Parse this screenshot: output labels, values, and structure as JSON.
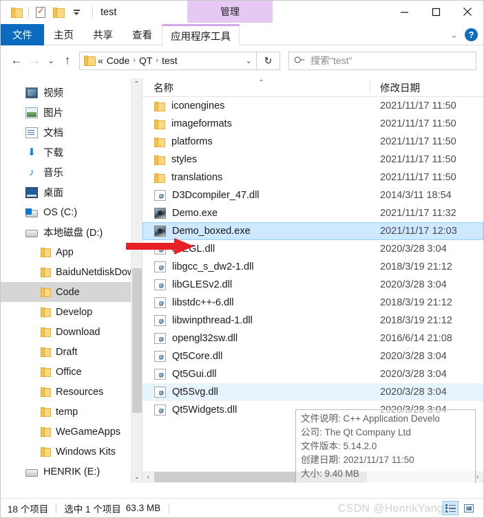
{
  "window": {
    "title": "test",
    "quick_access": [
      {
        "name": "folder-icon",
        "label": ""
      },
      {
        "name": "properties-icon",
        "label": ""
      },
      {
        "name": "new-folder-icon",
        "label": ""
      },
      {
        "name": "customize-qat-caret",
        "label": ""
      }
    ],
    "context_tab": "管理",
    "controls": {
      "minimize": "—",
      "maximize": "☐",
      "close": "✕"
    }
  },
  "ribbon": {
    "tabs": [
      {
        "label": "文件",
        "state": "file-menu"
      },
      {
        "label": "主页",
        "state": "normal"
      },
      {
        "label": "共享",
        "state": "normal"
      },
      {
        "label": "查看",
        "state": "normal"
      },
      {
        "label": "应用程序工具",
        "state": "contextual-active"
      }
    ],
    "collapse_chevron": "⌄",
    "help_label": "?"
  },
  "address_bar": {
    "back": "←",
    "forward": "→",
    "recent_caret": "⌄",
    "up": "↑",
    "breadcrumb_prefix": "«",
    "breadcrumb": [
      "Code",
      "QT",
      "test"
    ],
    "breadcrumb_separator": "›",
    "breadcrumb_caret": "⌄",
    "refresh": "↻",
    "search_placeholder": "搜索\"test\"",
    "search_value": ""
  },
  "sidebar": {
    "items": [
      {
        "label": "视频",
        "icon": "video-icon",
        "type": "library",
        "selected": false
      },
      {
        "label": "图片",
        "icon": "pictures-icon",
        "type": "library",
        "selected": false
      },
      {
        "label": "文档",
        "icon": "documents-icon",
        "type": "library",
        "selected": false
      },
      {
        "label": "下载",
        "icon": "downloads-icon",
        "type": "library",
        "selected": false
      },
      {
        "label": "音乐",
        "icon": "music-icon",
        "type": "library",
        "selected": false
      },
      {
        "label": "桌面",
        "icon": "desktop-icon",
        "type": "library",
        "selected": false
      },
      {
        "label": "OS (C:)",
        "icon": "os-drive-icon",
        "type": "drive",
        "selected": false
      },
      {
        "label": "本地磁盘 (D:)",
        "icon": "drive-icon",
        "type": "drive",
        "selected": false
      },
      {
        "label": "App",
        "icon": "folder-icon",
        "type": "folder",
        "selected": false
      },
      {
        "label": "BaiduNetdiskDow",
        "icon": "folder-icon",
        "type": "folder",
        "selected": false
      },
      {
        "label": "Code",
        "icon": "folder-icon",
        "type": "folder",
        "selected": true
      },
      {
        "label": "Develop",
        "icon": "folder-icon",
        "type": "folder",
        "selected": false
      },
      {
        "label": "Download",
        "icon": "folder-icon",
        "type": "folder",
        "selected": false
      },
      {
        "label": "Draft",
        "icon": "folder-icon",
        "type": "folder",
        "selected": false
      },
      {
        "label": "Office",
        "icon": "folder-icon",
        "type": "folder",
        "selected": false
      },
      {
        "label": "Resources",
        "icon": "folder-icon",
        "type": "folder",
        "selected": false
      },
      {
        "label": "temp",
        "icon": "folder-icon",
        "type": "folder",
        "selected": false
      },
      {
        "label": "WeGameApps",
        "icon": "folder-icon",
        "type": "folder",
        "selected": false
      },
      {
        "label": "Windows Kits",
        "icon": "folder-icon",
        "type": "folder",
        "selected": false
      },
      {
        "label": "HENRIK (E:)",
        "icon": "drive-icon",
        "type": "drive",
        "selected": false
      }
    ],
    "scroll_up": "⌃",
    "scroll_down": "⌄"
  },
  "file_list": {
    "columns": [
      {
        "label": "名称",
        "sorted": "asc",
        "sort_glyph": "⌃"
      },
      {
        "label": "修改日期",
        "sorted": "none",
        "sort_glyph": ""
      }
    ],
    "rows": [
      {
        "name": "iconengines",
        "date": "2021/11/17 11:50",
        "icon": "folder-icon",
        "state": "normal"
      },
      {
        "name": "imageformats",
        "date": "2021/11/17 11:50",
        "icon": "folder-icon",
        "state": "normal"
      },
      {
        "name": "platforms",
        "date": "2021/11/17 11:50",
        "icon": "folder-icon",
        "state": "normal"
      },
      {
        "name": "styles",
        "date": "2021/11/17 11:50",
        "icon": "folder-icon",
        "state": "normal"
      },
      {
        "name": "translations",
        "date": "2021/11/17 11:50",
        "icon": "folder-icon",
        "state": "normal"
      },
      {
        "name": "D3Dcompiler_47.dll",
        "date": "2014/3/11 18:54",
        "icon": "dll-icon",
        "state": "normal"
      },
      {
        "name": "Demo.exe",
        "date": "2021/11/17 11:32",
        "icon": "exe-icon",
        "state": "normal"
      },
      {
        "name": "Demo_boxed.exe",
        "date": "2021/11/17 12:03",
        "icon": "exe-icon",
        "state": "selected"
      },
      {
        "name": "libEGL.dll",
        "date": "2020/3/28 3:04",
        "icon": "dll-icon",
        "state": "normal"
      },
      {
        "name": "libgcc_s_dw2-1.dll",
        "date": "2018/3/19 21:12",
        "icon": "dll-icon",
        "state": "normal"
      },
      {
        "name": "libGLESv2.dll",
        "date": "2020/3/28 3:04",
        "icon": "dll-icon",
        "state": "normal"
      },
      {
        "name": "libstdc++-6.dll",
        "date": "2018/3/19 21:12",
        "icon": "dll-icon",
        "state": "normal"
      },
      {
        "name": "libwinpthread-1.dll",
        "date": "2018/3/19 21:12",
        "icon": "dll-icon",
        "state": "normal"
      },
      {
        "name": "opengl32sw.dll",
        "date": "2016/6/14 21:08",
        "icon": "dll-icon",
        "state": "normal"
      },
      {
        "name": "Qt5Core.dll",
        "date": "2020/3/28 3:04",
        "icon": "dll-icon",
        "state": "normal"
      },
      {
        "name": "Qt5Gui.dll",
        "date": "2020/3/28 3:04",
        "icon": "dll-icon",
        "state": "normal"
      },
      {
        "name": "Qt5Svg.dll",
        "date": "2020/3/28 3:04",
        "icon": "dll-icon",
        "state": "hover"
      },
      {
        "name": "Qt5Widgets.dll",
        "date": "2020/3/28 3:04",
        "icon": "dll-icon",
        "state": "normal"
      }
    ],
    "hscroll_left": "‹",
    "hscroll_right": "›"
  },
  "tooltip": {
    "lines": [
      "文件说明: C++ Application Develo",
      "公司: The Qt Company Ltd",
      "文件版本: 5.14.2.0",
      "创建日期: 2021/11/17 11:50",
      "大小: 9.40 MB"
    ]
  },
  "status_bar": {
    "item_count": "18 个项目",
    "selection": "选中 1 个项目",
    "selection_size": "63.3 MB",
    "watermark": "CSDN @HenrikYang",
    "view_details_label": "",
    "view_icons_label": ""
  },
  "annotation": {
    "arrow_color": "#e81f26"
  }
}
